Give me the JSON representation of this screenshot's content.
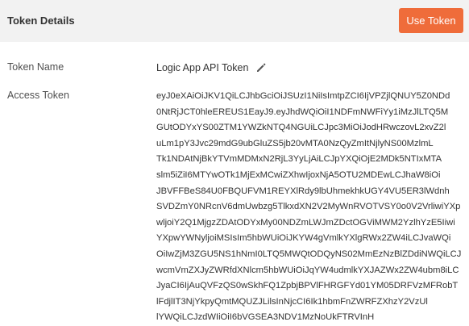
{
  "header": {
    "title": "Token Details",
    "use_token_label": "Use Token",
    "accent_color": "#ef6c3a"
  },
  "fields": {
    "token_name_label": "Token Name",
    "token_name_value": "Logic App API Token",
    "edit_icon": "pencil-icon",
    "access_token_label": "Access Token",
    "access_token_lines": [
      "eyJ0eXAiOiJKV1QiLCJhbGciOiJSUzI1NiIsImtpZCI6IjVPZjlQNUY5Z0NDd",
      "0NtRjJCT0hleEREUS1EayJ9.eyJhdWQiOiI1NDFmNWFiYy1iMzJlLTQ5M",
      "GUtODYxYS00ZTM1YWZkNTQ4NGUiLCJpc3MiOiJodHRwczovL2xvZ2l",
      "uLm1pY3Jvc29mdG9ubGluZS5jb20vMTA0NzQyZmItNjlyNS00MzlmL",
      "Tk1NDAtNjBkYTVmMDMxN2RjL3YyLjAiLCJpYXQiOjE2MDk5NTIxMTA",
      "slm5iZiI6MTYwOTk1MjExMCwiZXhwIjoxNjA5OTU2MDEwLCJhaW8iOi",
      "JBVFFBeS84U0FBQUFVM1REYXlRdy9lbUhmekhkUGY4VU5ER3lWdnh",
      "SVDZmY0NRcnV6dmUwbzg5TlkxdXN2V2MyWnRVOTVSY0o0V2VrliwiYXp",
      "wljoiY2Q1MjgzZDAtODYxMy00NDZmLWJmZDctOGViMWM2YzlhYzE5Iiwi",
      "YXpwYWNyljoiMSIsIm5hbWUiOiJKYW4gVmlkYXlgRWx2ZW4iLCJvaWQi",
      "OiIwZjM3ZGU5NS1hNmI0LTQ5MWQtODQyNS02MmEzNzBlZDdiNWQiLCJ",
      "wcmVmZXJyZWRfdXNlcm5hbWUiOiJqYW4udmlkYXJAZWx2ZW4ubm8iLC",
      "JyaCI6IjAuQVFzQS0wSkhFQ1ZpbjBPVlFHRGFYd01YM05DRFVzMFRobT",
      "lFdjlIT3NjYkpyQmtMQUZJLilsInNjcCI6Ik1hbmFnZWRFZXhzY2VzUl",
      "lYWQiLCJzdWIiOiI6bVGSEA3NDV1MzNoUkFTRVInH"
    ]
  }
}
